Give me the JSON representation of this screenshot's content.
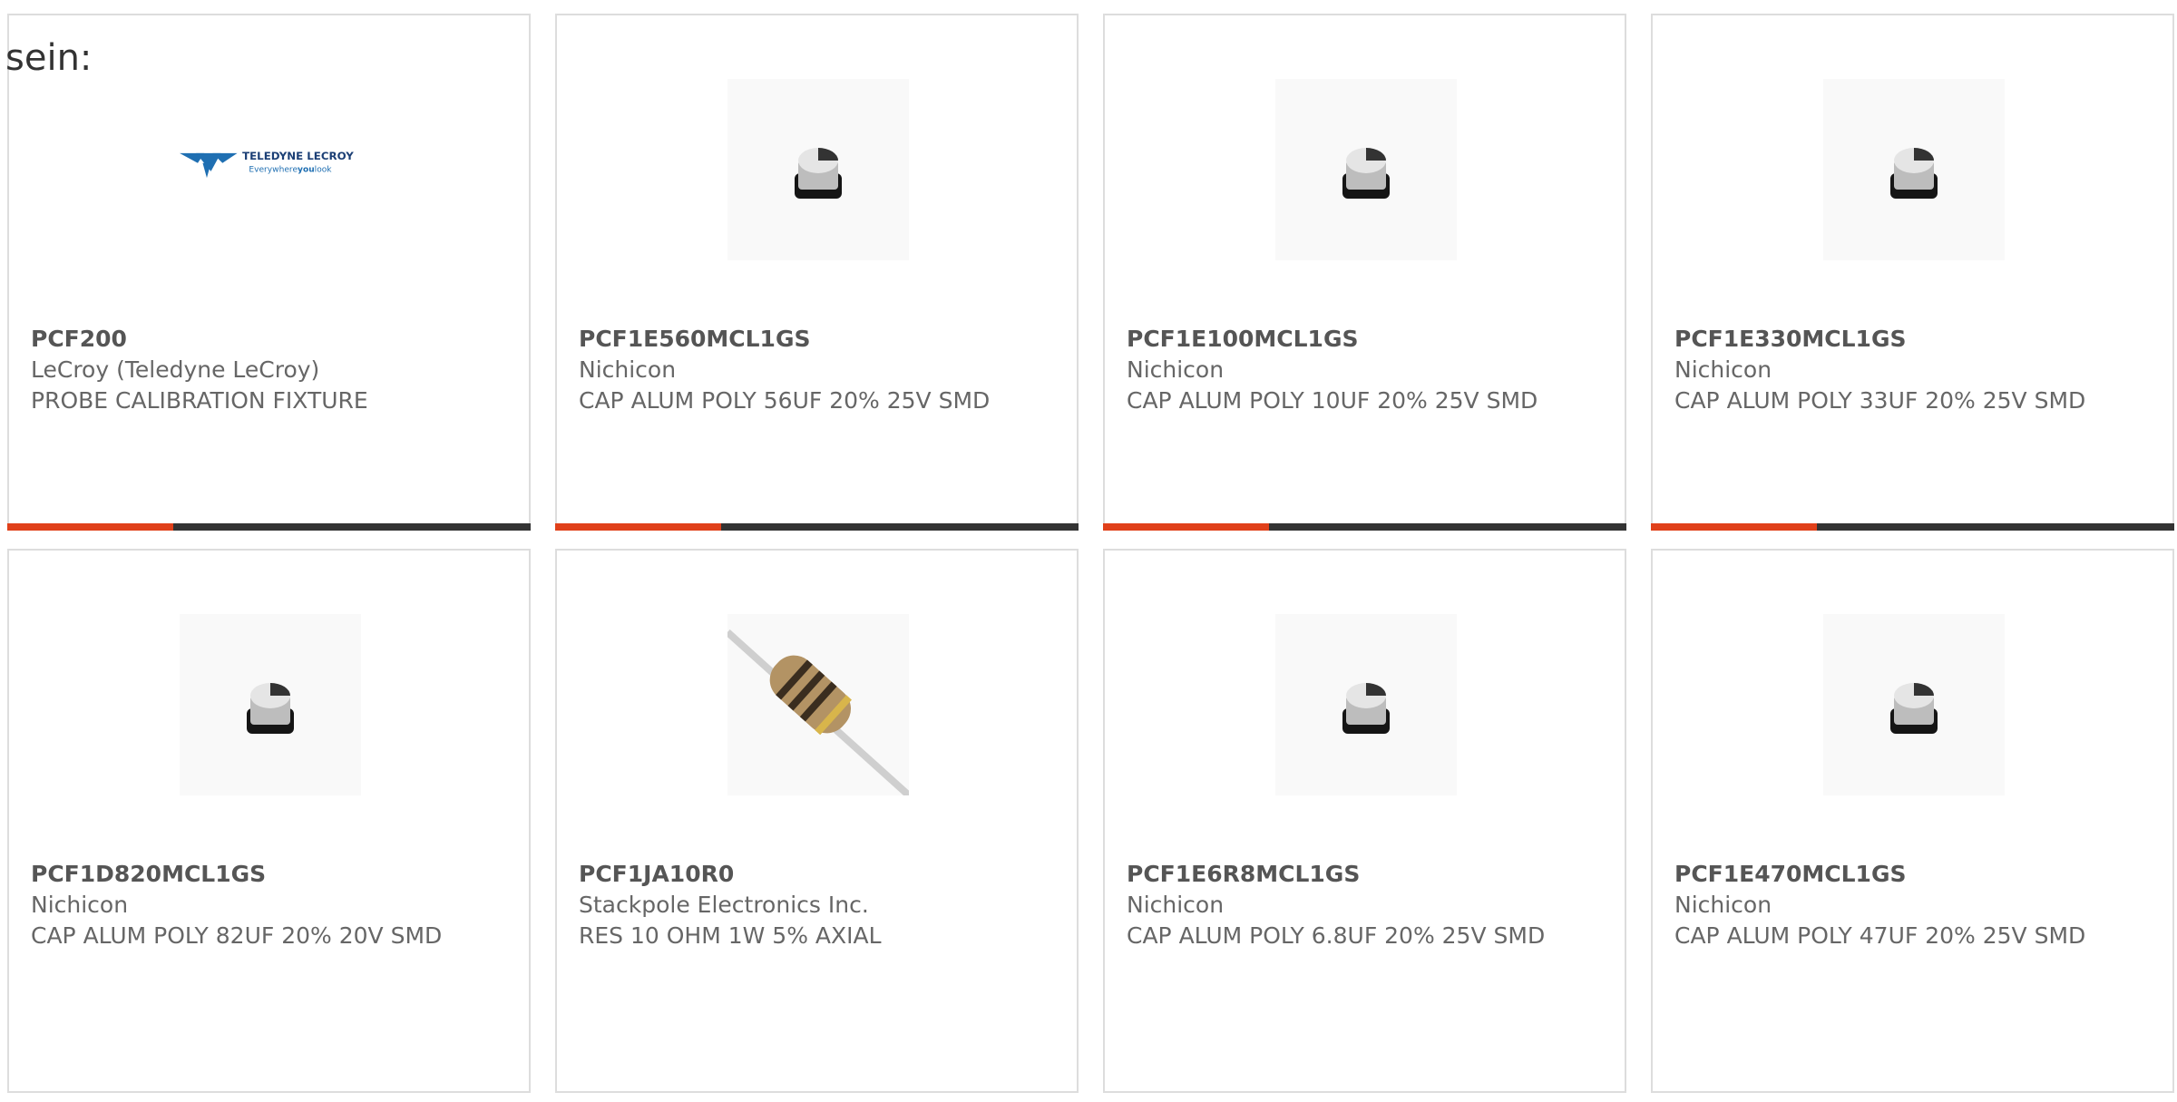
{
  "intro_text": "sein:",
  "products": [
    {
      "part_number": "PCF200",
      "manufacturer": "LeCroy (Teledyne LeCroy)",
      "description": "PROBE CALIBRATION FIXTURE",
      "image": "teledyne-lecroy-logo"
    },
    {
      "part_number": "PCF1E560MCL1GS",
      "manufacturer": "Nichicon",
      "description": "CAP ALUM POLY 56UF 20% 25V SMD",
      "image": "capacitor-photo"
    },
    {
      "part_number": "PCF1E100MCL1GS",
      "manufacturer": "Nichicon",
      "description": "CAP ALUM POLY 10UF 20% 25V SMD",
      "image": "capacitor-photo"
    },
    {
      "part_number": "PCF1E330MCL1GS",
      "manufacturer": "Nichicon",
      "description": "CAP ALUM POLY 33UF 20% 25V SMD",
      "image": "capacitor-photo"
    },
    {
      "part_number": "PCF1D820MCL1GS",
      "manufacturer": "Nichicon",
      "description": "CAP ALUM POLY 82UF 20% 20V SMD",
      "image": "capacitor-photo"
    },
    {
      "part_number": "PCF1JA10R0",
      "manufacturer": "Stackpole Electronics Inc.",
      "description": "RES 10 OHM 1W 5% AXIAL",
      "image": "resistor-photo"
    },
    {
      "part_number": "PCF1E6R8MCL1GS",
      "manufacturer": "Nichicon",
      "description": "CAP ALUM POLY 6.8UF 20% 25V SMD",
      "image": "capacitor-photo"
    },
    {
      "part_number": "PCF1E470MCL1GS",
      "manufacturer": "Nichicon",
      "description": "CAP ALUM POLY 47UF 20% 25V SMD",
      "image": "capacitor-photo"
    }
  ],
  "logo": {
    "brand": "TELEDYNE LECROY",
    "tagline_prefix": "Everywhere",
    "tagline_emphasis": "you",
    "tagline_suffix": "look"
  },
  "colors": {
    "accent": "#e0401a",
    "bar_dark": "#333333",
    "text": "#666666",
    "border": "#dddddd",
    "logo_blue": "#1f6fb2"
  }
}
